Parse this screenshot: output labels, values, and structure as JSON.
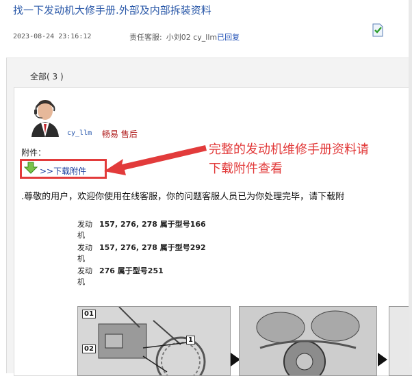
{
  "ticket": {
    "title": "找一下发动机大修手册.外部及内部拆装资料",
    "datetime": "2023-08-24 23:16:12",
    "agent_label": "责任客服:",
    "agent_name": "小刘02 cy_llm",
    "status": "已回复",
    "status_icon": "check-document-icon"
  },
  "tabs": {
    "all_label": "全部( 3 )"
  },
  "reply": {
    "username": "cy_llm",
    "department": "畅易 售后",
    "attachment_label": "附件：",
    "attachment_link": ">>下载附件",
    "note_line1": "完整的发动机维修手册资料请",
    "note_line2": "下载附件查看",
    "message": ".尊敬的用户，欢迎你使用在线客服，你的问题客服人员已为你处理完毕，请下载附"
  },
  "engines": [
    {
      "label": "发动机",
      "text": "157, 276, 278 属于型号166"
    },
    {
      "label": "发动机",
      "text": "157, 276, 278 属于型号292"
    },
    {
      "label": "发动机",
      "text": "276 属于型号251"
    }
  ],
  "figure_callouts": [
    "01",
    "1",
    "02"
  ],
  "colors": {
    "accent": "#e23b3b",
    "link": "#1a3c9c",
    "title": "#2a58a8"
  }
}
